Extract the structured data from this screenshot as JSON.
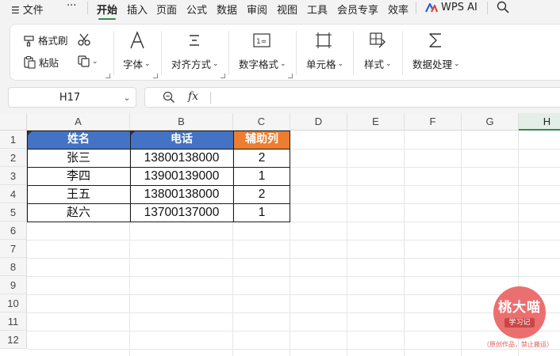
{
  "menubar": {
    "file_label": "文件",
    "more_label": "···",
    "tabs": [
      "开始",
      "插入",
      "页面",
      "公式",
      "数据",
      "审阅",
      "视图",
      "工具",
      "会员专享",
      "效率"
    ],
    "wps_ai_label": "WPS AI"
  },
  "ribbon": {
    "format_painter_label": "格式刷",
    "paste_label": "粘贴",
    "font_label": "字体",
    "align_label": "对齐方式",
    "number_format_label": "数字格式",
    "cell_label": "单元格",
    "style_label": "样式",
    "data_process_label": "数据处理",
    "number_icon_text": "1="
  },
  "formula_bar": {
    "name_box": "H17",
    "fx_label": "fx",
    "value": ""
  },
  "sheet": {
    "columns": [
      "A",
      "B",
      "C",
      "D",
      "E",
      "F",
      "G",
      "H"
    ],
    "selected_column": "H",
    "rows": [
      "1",
      "2",
      "3",
      "4",
      "5",
      "6",
      "7",
      "8",
      "9",
      "10",
      "11",
      "12"
    ],
    "header_row": [
      "姓名",
      "电话",
      "辅助列"
    ],
    "data": [
      [
        "张三",
        "13800138000",
        "2"
      ],
      [
        "李四",
        "13900139000",
        "1"
      ],
      [
        "王五",
        "13800138000",
        "2"
      ],
      [
        "赵六",
        "13700137000",
        "1"
      ]
    ]
  },
  "colors": {
    "accent_green": "#2f8a4f",
    "header_blue": "#4472c4",
    "header_orange": "#ed7d31",
    "watermark_red": "#ec6f6f"
  },
  "watermark": {
    "title": "桃大喵",
    "subtitle": "学习记",
    "note": "（原创作品，禁止搬运）"
  }
}
